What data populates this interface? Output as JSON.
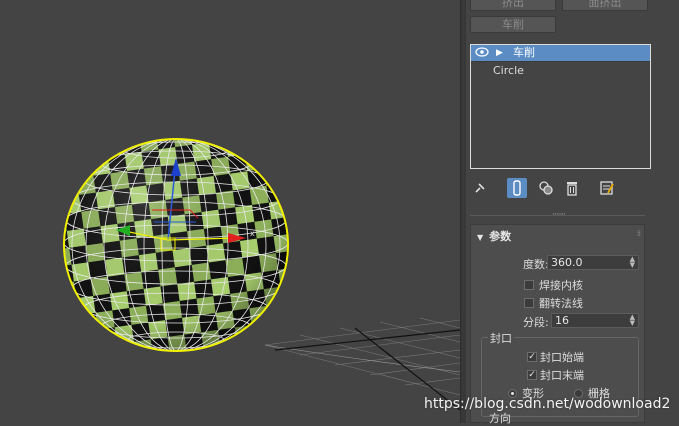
{
  "top_buttons": {
    "extrude": "挤出",
    "face_extrude": "面挤出",
    "lathe": "车削"
  },
  "modifier_stack": {
    "items": [
      {
        "label": "车削",
        "selected": true
      },
      {
        "label": "Circle",
        "selected": false
      }
    ]
  },
  "toolbar_icons": [
    "pin-stack-icon",
    "show-end-result-icon",
    "make-unique-icon",
    "remove-modifier-icon",
    "configure-modifier-sets-icon"
  ],
  "rollout": {
    "title": "参数",
    "degrees_label": "度数:",
    "degrees_value": "360.0",
    "weld_core_label": "焊接内核",
    "weld_core_checked": false,
    "flip_normals_label": "翻转法线",
    "flip_normals_checked": false,
    "segments_label": "分段:",
    "segments_value": "16",
    "capping": {
      "title": "封口",
      "cap_start_label": "封口始端",
      "cap_start_checked": true,
      "cap_end_label": "封口末端",
      "cap_end_checked": true,
      "morph_label": "变形",
      "grid_label": "栅格",
      "selected": "变形"
    },
    "direction_title": "方向"
  },
  "colors": {
    "selection_blue": "#5b8dc4",
    "wire_yellow": "#f0f000",
    "mesh_green": "#9bc46a"
  },
  "watermark": "https://blog.csdn.net/wodownload2"
}
